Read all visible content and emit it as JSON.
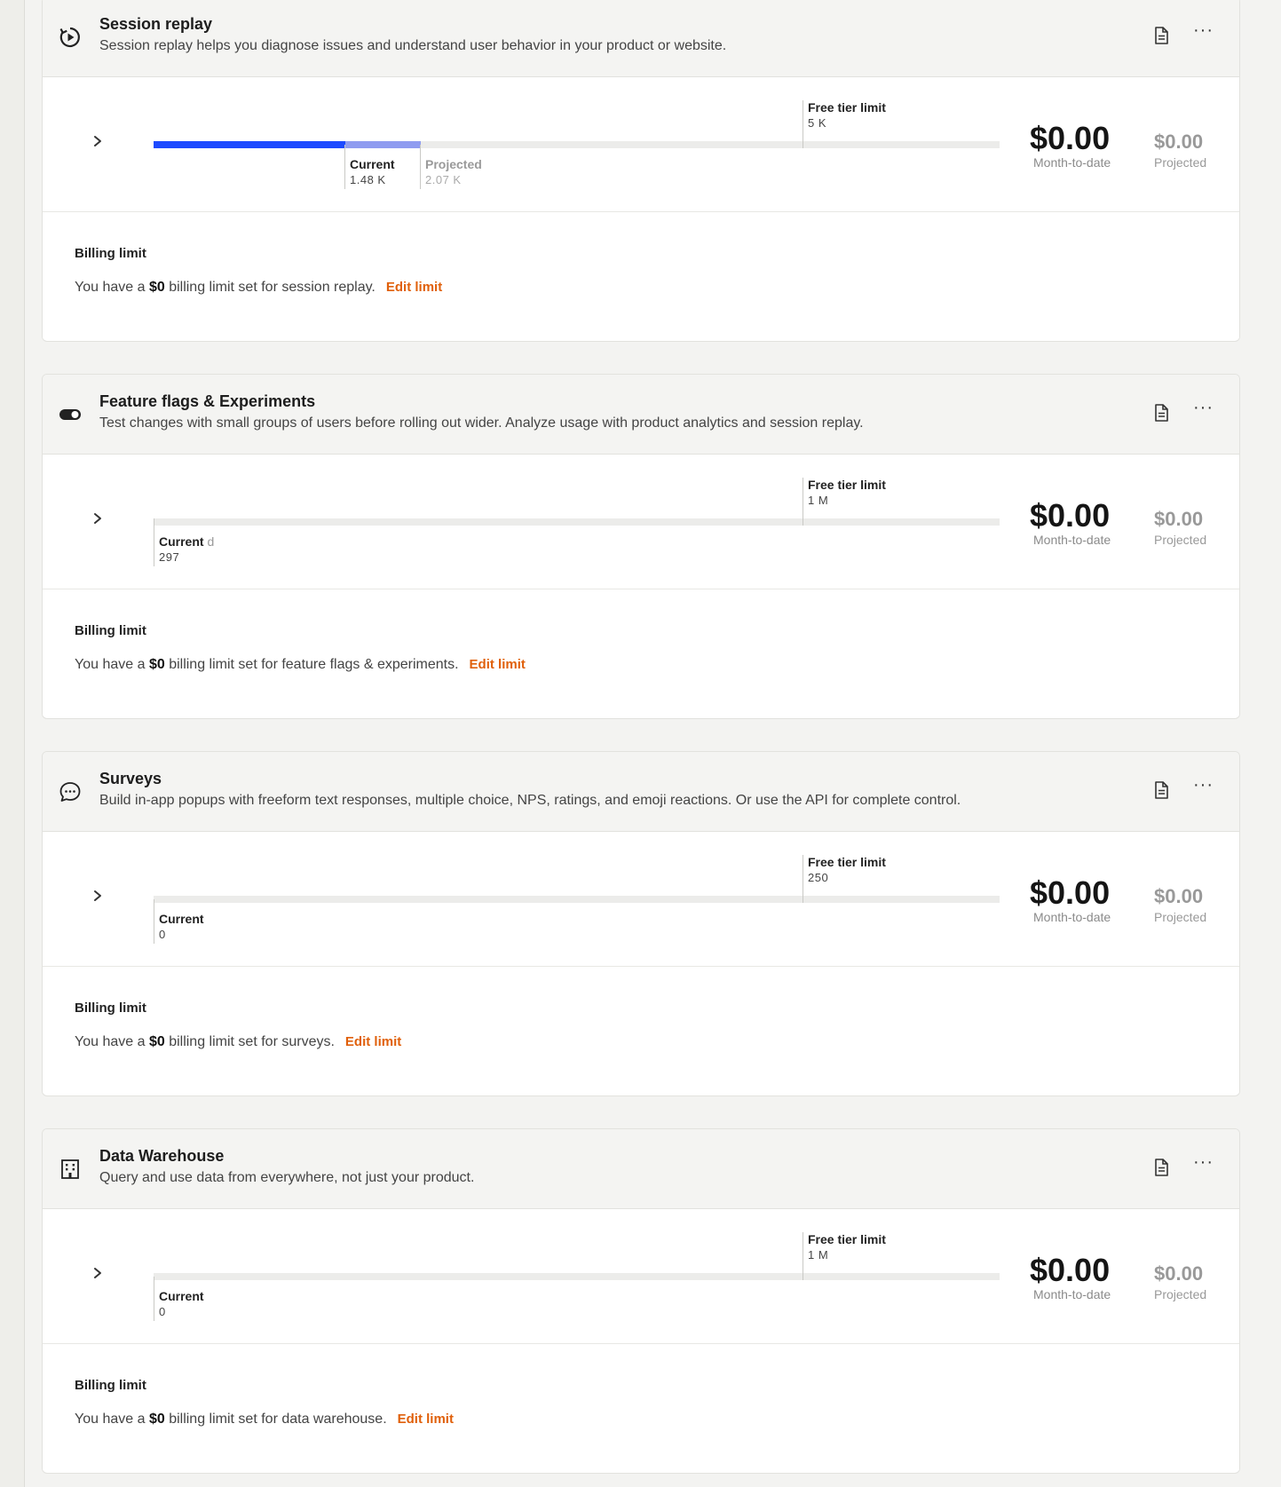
{
  "products": [
    {
      "id": "session-replay",
      "icon": "replay-icon",
      "title": "Session replay",
      "description": "Session replay helps you diagnose issues and understand user behavior in your product or website.",
      "free_tier_label": "Free tier limit",
      "free_tier_value": "5 K",
      "current_label": "Current",
      "current_suffix": "",
      "current_value": "1.48 K",
      "projected_label": "Projected",
      "projected_value": "2.07 K",
      "current_fraction": 0.2266,
      "projected_fraction": 0.3162,
      "free_tier_fraction": 0.7675,
      "amount": "$0.00",
      "amount_label": "Month-to-date",
      "projected_amount": "$0.00",
      "projected_amount_label": "Projected",
      "billing_title": "Billing limit",
      "billing_prefix": "You have a",
      "billing_amount": "$0",
      "billing_suffix": "billing limit set for session replay.",
      "edit_label": "Edit limit"
    },
    {
      "id": "feature-flags",
      "icon": "toggle-icon",
      "title": "Feature flags & Experiments",
      "description": "Test changes with small groups of users before rolling out wider. Analyze usage with product analytics and session replay.",
      "free_tier_label": "Free tier limit",
      "free_tier_value": "1 M",
      "current_label": "Current",
      "current_suffix": "d",
      "current_value": "297",
      "projected_label": "",
      "projected_value": "",
      "current_fraction": 0.0002,
      "projected_fraction": 0,
      "free_tier_fraction": 0.7675,
      "amount": "$0.00",
      "amount_label": "Month-to-date",
      "projected_amount": "$0.00",
      "projected_amount_label": "Projected",
      "billing_title": "Billing limit",
      "billing_prefix": "You have a",
      "billing_amount": "$0",
      "billing_suffix": "billing limit set for feature flags & experiments.",
      "edit_label": "Edit limit"
    },
    {
      "id": "surveys",
      "icon": "chat-bubble-icon",
      "title": "Surveys",
      "description": "Build in-app popups with freeform text responses, multiple choice, NPS, ratings, and emoji reactions. Or use the API for complete control.",
      "free_tier_label": "Free tier limit",
      "free_tier_value": "250",
      "current_label": "Current",
      "current_suffix": "",
      "current_value": "0",
      "projected_label": "",
      "projected_value": "",
      "current_fraction": 0,
      "projected_fraction": 0,
      "free_tier_fraction": 0.7675,
      "amount": "$0.00",
      "amount_label": "Month-to-date",
      "projected_amount": "$0.00",
      "projected_amount_label": "Projected",
      "billing_title": "Billing limit",
      "billing_prefix": "You have a",
      "billing_amount": "$0",
      "billing_suffix": "billing limit set for surveys.",
      "edit_label": "Edit limit"
    },
    {
      "id": "data-warehouse",
      "icon": "building-icon",
      "title": "Data Warehouse",
      "description": "Query and use data from everywhere, not just your product.",
      "free_tier_label": "Free tier limit",
      "free_tier_value": "1 M",
      "current_label": "Current",
      "current_suffix": "",
      "current_value": "0",
      "projected_label": "",
      "projected_value": "",
      "current_fraction": 0,
      "projected_fraction": 0,
      "free_tier_fraction": 0.7675,
      "amount": "$0.00",
      "amount_label": "Month-to-date",
      "projected_amount": "$0.00",
      "projected_amount_label": "Projected",
      "billing_title": "Billing limit",
      "billing_prefix": "You have a",
      "billing_amount": "$0",
      "billing_suffix": "billing limit set for data warehouse.",
      "edit_label": "Edit limit"
    }
  ],
  "colors": {
    "current_fill": "#1d4aff",
    "projected_fill": "#8f9cf0",
    "edit_link": "#e0600b"
  }
}
